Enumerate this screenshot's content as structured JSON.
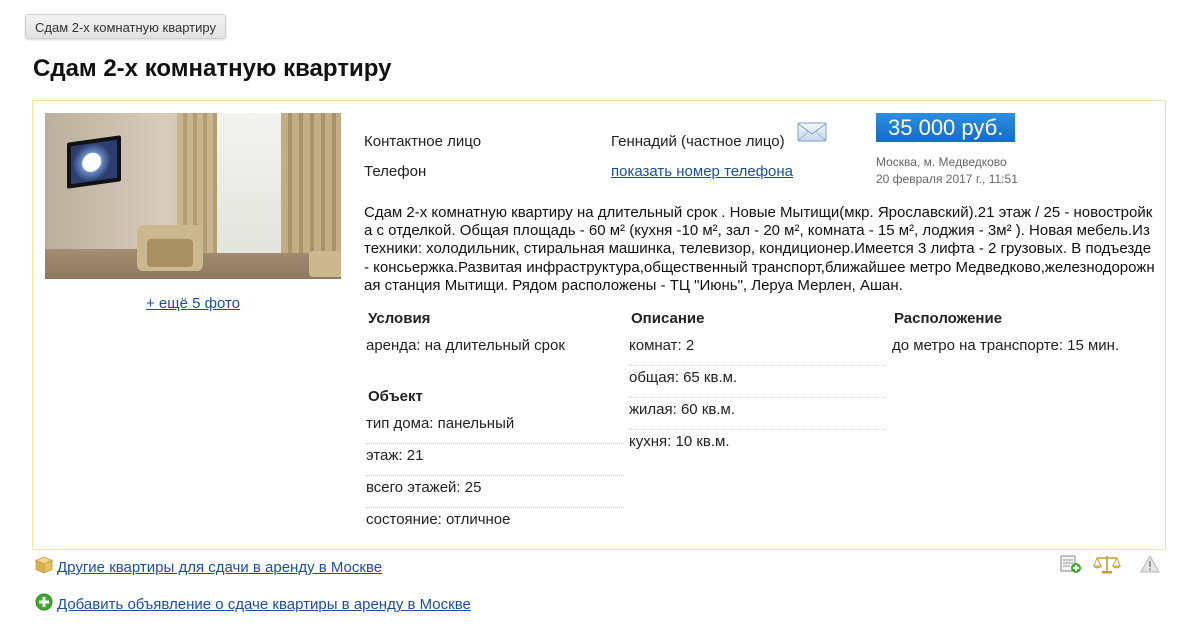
{
  "breadcrumb": "Сдам 2-х комнатную квартиру",
  "title": "Сдам 2-х комнатную квартиру",
  "photo": {
    "more_link": "+ ещё 5 фото"
  },
  "contact": {
    "person_label": "Контактное лицо",
    "person_value": "Геннадий (частное лицо)",
    "phone_label": "Телефон",
    "phone_link": "показать номер телефона"
  },
  "price": "35 000 руб.",
  "location": "Москва, м. Медведково",
  "datetime": "20 февраля 2017 г., 11:51",
  "description": "Сдам 2-х комнатную квартиру на длительный срок . Новые Мытищи(мкр. Ярославский).21 этаж / 25 - новостройка с отделкой. Общая площадь - 60 м² (кухня -10 м², зал - 20 м², комната - 15 м², лоджия - 3м² ). Новая мебель.Из техники: холодильник, стиральная машинка, телевизор, кондиционер.Имеется 3 лифта - 2 грузовых. В подъезде - консьержка.Развитая инфраструктура,общественный транспорт,ближайшее метро Медведково,железнодорожная станция Мытищи. Рядом расположены - ТЦ \"Июнь\", Леруа Мерлен, Ашан.",
  "conditions": {
    "heading": "Условия",
    "items": [
      "аренда: на длительный срок"
    ]
  },
  "object": {
    "heading": "Объект",
    "items": [
      "тип дома: панельный",
      "этаж: 21",
      "всего этажей: 25",
      "состояние: отличное"
    ]
  },
  "description_section": {
    "heading": "Описание",
    "items": [
      "комнат: 2",
      "общая: 65 кв.м.",
      "жилая: 60 кв.м.",
      "кухня: 10 кв.м."
    ]
  },
  "location_section": {
    "heading": "Расположение",
    "items": [
      "до метро на транспорте: 15 мин."
    ]
  },
  "footer": {
    "other_link": "Другие квартиры для сдачи в аренду в Москве",
    "add_link": "Добавить объявление о сдаче квартиры в аренду в Москве"
  },
  "colors": {
    "price_bg": "#1a7bd6",
    "link": "#1b4f9c",
    "card_border": "#f1e3a2"
  }
}
